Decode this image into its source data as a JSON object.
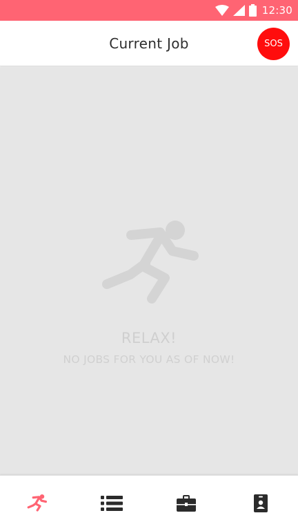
{
  "status_bar": {
    "time": "12:30",
    "icons": [
      "wifi-icon",
      "signal-icon",
      "battery-icon"
    ],
    "background": "#ff6473"
  },
  "app_bar": {
    "title": "Current Job",
    "sos_label": "SOS",
    "sos_color": "#ff0d0d"
  },
  "empty_state": {
    "icon": "running-person-icon",
    "title": "RELAX!",
    "subtitle": "NO JOBS FOR YOU AS OF NOW!"
  },
  "bottom_nav": {
    "items": [
      {
        "icon": "running-person-icon",
        "active": true,
        "color": "#ff6473"
      },
      {
        "icon": "list-icon",
        "active": false,
        "color": "#2b2b2b"
      },
      {
        "icon": "briefcase-icon",
        "active": false,
        "color": "#2b2b2b"
      },
      {
        "icon": "id-badge-icon",
        "active": false,
        "color": "#2b2b2b"
      }
    ]
  }
}
